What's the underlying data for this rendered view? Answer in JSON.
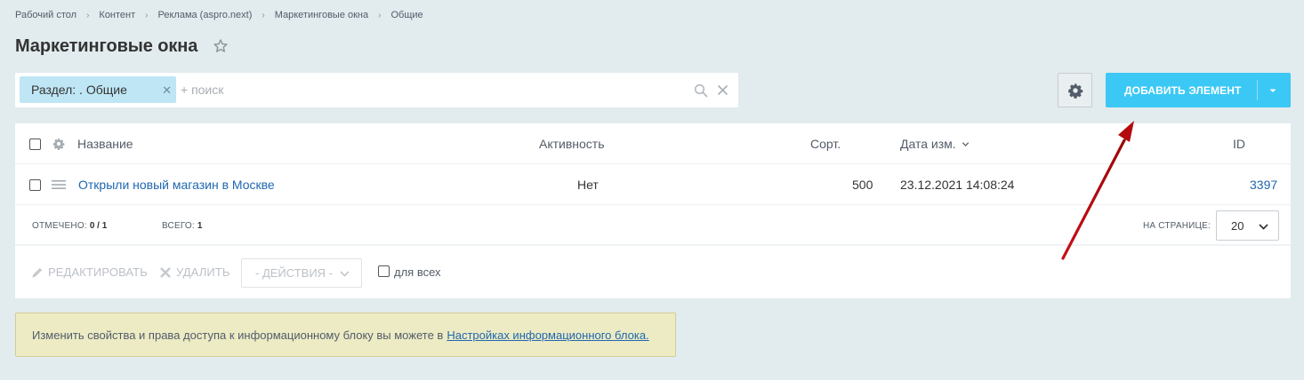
{
  "breadcrumb": [
    "Рабочий стол",
    "Контент",
    "Реклама (aspro.next)",
    "Маркетинговые окна",
    "Общие"
  ],
  "page": {
    "title": "Маркетинговые окна"
  },
  "filter": {
    "chip_label": "Раздел: . Общие",
    "placeholder": "+ поиск",
    "value": ""
  },
  "toolbar": {
    "add_label": "ДОБАВИТЬ ЭЛЕМЕНТ"
  },
  "grid": {
    "columns": {
      "name": "Название",
      "active": "Активность",
      "sort": "Сорт.",
      "date": "Дата изм.",
      "id": "ID"
    },
    "rows": [
      {
        "name": "Открыли новый магазин в Москве",
        "active": "Нет",
        "sort": "500",
        "date": "23.12.2021 14:08:24",
        "id": "3397"
      }
    ],
    "footer": {
      "selected_label": "ОТМЕЧЕНО:",
      "selected_value": "0 / 1",
      "total_label": "ВСЕГО:",
      "total_value": "1",
      "per_page_label": "НА СТРАНИЦЕ:",
      "per_page_value": "20"
    },
    "actions": {
      "edit": "РЕДАКТИРОВАТЬ",
      "delete": "УДАЛИТЬ",
      "select": "- ДЕЙСТВИЯ -",
      "for_all": "для всех"
    }
  },
  "info": {
    "text": "Изменить свойства и права доступа к информационному блоку вы можете в",
    "link": "Настройках информационного блока."
  },
  "colors": {
    "accent": "#3bc8f5",
    "chip": "#bfe6f4",
    "link": "#2067b0",
    "arrow": "#b3090f",
    "info_bg": "#ecebc4"
  }
}
